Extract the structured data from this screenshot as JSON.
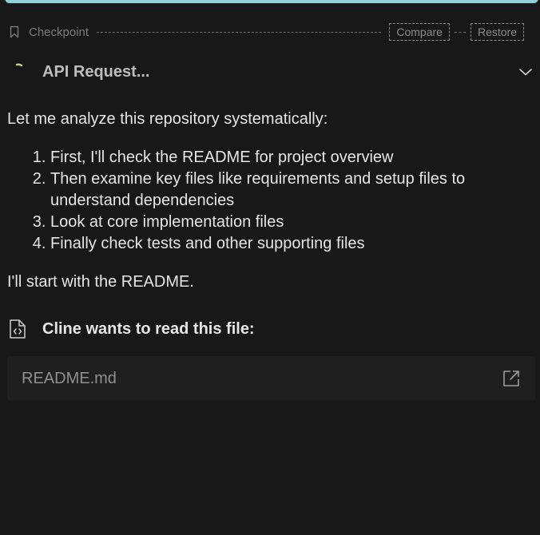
{
  "checkpoint": {
    "label": "Checkpoint",
    "compare_label": "Compare",
    "restore_label": "Restore"
  },
  "api_request": {
    "title": "API Request..."
  },
  "message": {
    "intro": "Let me analyze this repository systematically:",
    "steps": [
      "First, I'll check the README for project overview",
      "Then examine key files like requirements and setup files to understand dependencies",
      "Look at core implementation files",
      "Finally check tests and other supporting files"
    ],
    "outro": "I'll start with the README."
  },
  "tool": {
    "title": "Cline wants to read this file:",
    "file_name": "README.md"
  },
  "colors": {
    "background": "#181818",
    "accent_bar": "#8ecfd8",
    "file_box": "#1f1f1f"
  },
  "icons": [
    "bookmark-icon",
    "spinner-icon",
    "chevron-down-icon",
    "file-code-icon",
    "external-link-icon"
  ]
}
